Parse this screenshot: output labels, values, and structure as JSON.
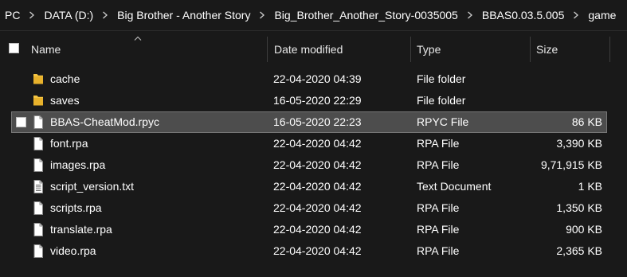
{
  "breadcrumb": [
    "PC",
    "DATA (D:)",
    "Big Brother - Another Story",
    "Big_Brother_Another_Story-0035005",
    "BBAS0.03.5.005",
    "game"
  ],
  "columns": {
    "name": "Name",
    "date_modified": "Date modified",
    "type": "Type",
    "size": "Size"
  },
  "files": [
    {
      "name": "cache",
      "date": "22-04-2020 04:39",
      "type": "File folder",
      "size": "",
      "icon": "folder-icon"
    },
    {
      "name": "saves",
      "date": "16-05-2020 22:29",
      "type": "File folder",
      "size": "",
      "icon": "folder-icon"
    },
    {
      "name": "BBAS-CheatMod.rpyc",
      "date": "16-05-2020 22:23",
      "type": "RPYC File",
      "size": "86 KB",
      "icon": "file-icon",
      "selected": true
    },
    {
      "name": "font.rpa",
      "date": "22-04-2020 04:42",
      "type": "RPA File",
      "size": "3,390 KB",
      "icon": "file-icon"
    },
    {
      "name": "images.rpa",
      "date": "22-04-2020 04:42",
      "type": "RPA File",
      "size": "9,71,915 KB",
      "icon": "file-icon"
    },
    {
      "name": "script_version.txt",
      "date": "22-04-2020 04:42",
      "type": "Text Document",
      "size": "1 KB",
      "icon": "text-file-icon"
    },
    {
      "name": "scripts.rpa",
      "date": "22-04-2020 04:42",
      "type": "RPA File",
      "size": "1,350 KB",
      "icon": "file-icon"
    },
    {
      "name": "translate.rpa",
      "date": "22-04-2020 04:42",
      "type": "RPA File",
      "size": "900 KB",
      "icon": "file-icon"
    },
    {
      "name": "video.rpa",
      "date": "22-04-2020 04:42",
      "type": "RPA File",
      "size": "2,365 KB",
      "icon": "file-icon"
    }
  ],
  "colors": {
    "background": "#191919",
    "selection": "#4d4d4d",
    "folder": "#f5c542"
  }
}
